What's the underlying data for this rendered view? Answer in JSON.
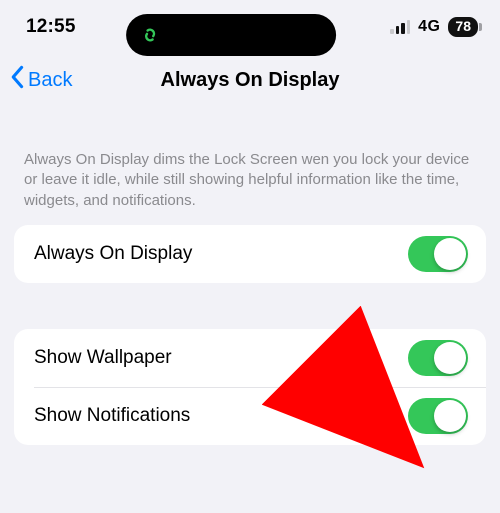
{
  "statusbar": {
    "time": "12:55",
    "network_label": "4G",
    "battery_percent": "78"
  },
  "nav": {
    "back_label": "Back",
    "title": "Always On Display"
  },
  "description": "Always On Display dims the Lock Screen wen you lock your device or leave it idle, while still showing helpful information like the time, widgets, and notifications.",
  "rows": {
    "aod": {
      "label": "Always On Display",
      "on": true
    },
    "wallpaper": {
      "label": "Show Wallpaper",
      "on": true
    },
    "notifications": {
      "label": "Show Notifications",
      "on": true
    }
  },
  "annotation": {
    "arrow_color": "#ff0000"
  }
}
